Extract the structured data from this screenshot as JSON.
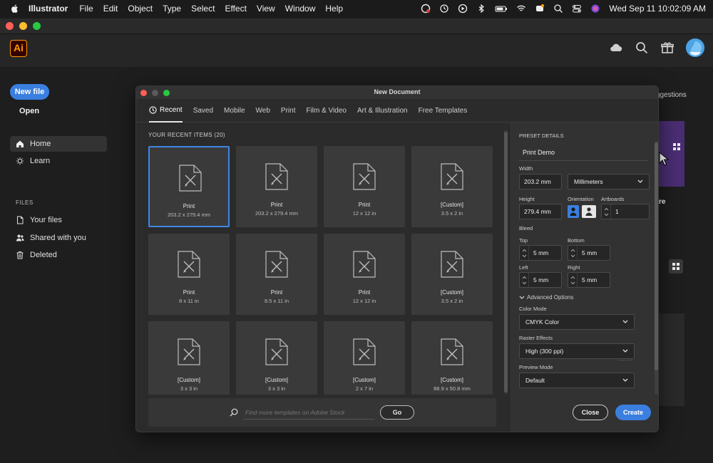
{
  "menubar": {
    "app": "Illustrator",
    "items": [
      "File",
      "Edit",
      "Object",
      "Type",
      "Select",
      "Effect",
      "View",
      "Window",
      "Help"
    ],
    "clock": "Wed Sep 11  10:02:09 AM"
  },
  "app": {
    "logo": "Ai",
    "header_icons": [
      "cloud-icon",
      "search-icon",
      "gift-icon",
      "avatar"
    ]
  },
  "sidebar": {
    "new_file": "New file",
    "open": "Open",
    "nav": [
      {
        "label": "Home",
        "icon": "home-icon"
      },
      {
        "label": "Learn",
        "icon": "lightbulb-icon"
      }
    ],
    "files_heading": "FILES",
    "files": [
      {
        "label": "Your files",
        "icon": "file-icon"
      },
      {
        "label": "Shared with you",
        "icon": "people-icon"
      },
      {
        "label": "Deleted",
        "icon": "trash-icon"
      }
    ]
  },
  "background": {
    "suggestions": "ggestions",
    "promo_letter": "re"
  },
  "dialog": {
    "title": "New Document",
    "tabs": [
      "Recent",
      "Saved",
      "Mobile",
      "Web",
      "Print",
      "Film & Video",
      "Art & Illustration",
      "Free Templates"
    ],
    "recent_heading": "YOUR RECENT ITEMS  (20)",
    "items": [
      {
        "name": "Print",
        "size": "203.2 x 279.4 mm"
      },
      {
        "name": "Print",
        "size": "203.2 x 279.4 mm"
      },
      {
        "name": "Print",
        "size": "12 x 12 in"
      },
      {
        "name": "[Custom]",
        "size": "3.5 x 2 in"
      },
      {
        "name": "Print",
        "size": "8 x 11 in"
      },
      {
        "name": "Print",
        "size": "8.5 x 11 in"
      },
      {
        "name": "Print",
        "size": "12 x 12 in"
      },
      {
        "name": "[Custom]",
        "size": "3.5 x 2 in"
      },
      {
        "name": "[Custom]",
        "size": "3 x 3 in"
      },
      {
        "name": "[Custom]",
        "size": "3 x 3 in"
      },
      {
        "name": "[Custom]",
        "size": "2 x 7 in"
      },
      {
        "name": "[Custom]",
        "size": "88.9 x 50.8 mm"
      }
    ],
    "stock_placeholder": "Find more templates on Adobe Stock",
    "go": "Go",
    "preset": {
      "heading": "PRESET DETAILS",
      "name": "Print Demo",
      "width_label": "Width",
      "width": "203.2 mm",
      "units": "Millimeters",
      "height_label": "Height",
      "height": "279.4 mm",
      "orientation_label": "Orientation",
      "artboards_label": "Artboards",
      "artboards": "1",
      "bleed_label": "Bleed",
      "top_label": "Top",
      "top": "5 mm",
      "bottom_label": "Bottom",
      "bottom": "5 mm",
      "left_label": "Left",
      "left": "5 mm",
      "right_label": "Right",
      "right": "5 mm",
      "advanced": "Advanced Options",
      "color_mode_label": "Color Mode",
      "color_mode": "CMYK Color",
      "raster_label": "Raster Effects",
      "raster": "High (300 ppi)",
      "preview_label": "Preview Mode",
      "preview": "Default"
    },
    "close": "Close",
    "create": "Create"
  },
  "colors": {
    "accent": "#3a7fe0",
    "ai_orange": "#ff9a00",
    "selected_border": "#3f86e6"
  }
}
